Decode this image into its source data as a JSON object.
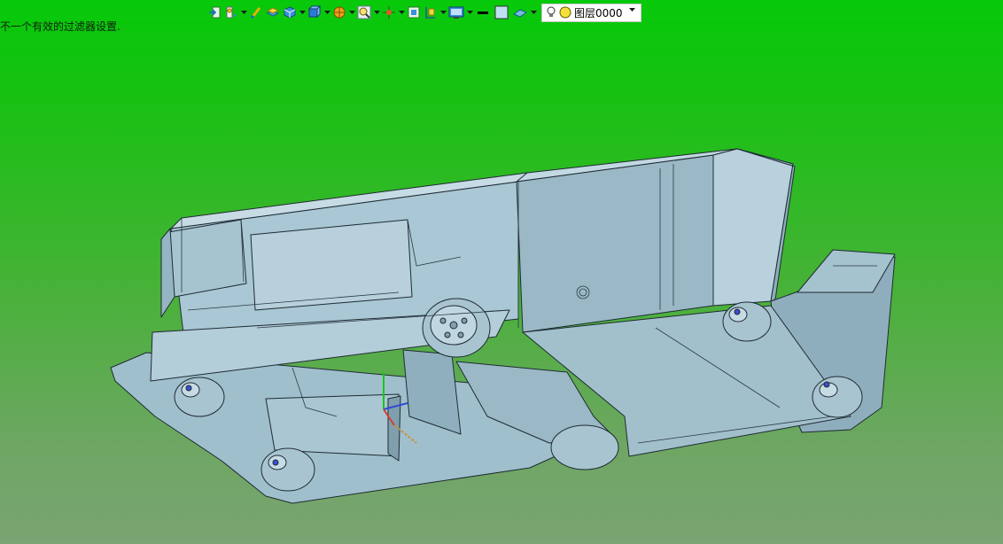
{
  "status": {
    "message": "不一个有效的过滤器设置."
  },
  "toolbar": {
    "buttons": [
      {
        "name": "exit-icon",
        "has_dropdown": false
      },
      {
        "name": "light-icon",
        "has_dropdown": true
      },
      {
        "name": "brush-icon",
        "has_dropdown": false
      },
      {
        "name": "layers-icon",
        "has_dropdown": false
      },
      {
        "name": "cube-icon",
        "has_dropdown": true
      },
      {
        "name": "view-cube-icon",
        "has_dropdown": true
      },
      {
        "name": "orbit-icon",
        "has_dropdown": true
      },
      {
        "name": "zoom-icon",
        "has_dropdown": true
      },
      {
        "name": "pan-icon",
        "has_dropdown": true
      },
      {
        "name": "fit-icon",
        "has_dropdown": false
      },
      {
        "name": "section-icon",
        "has_dropdown": true
      },
      {
        "name": "display-mode-icon",
        "has_dropdown": true
      },
      {
        "name": "line-color-icon",
        "has_dropdown": false
      },
      {
        "name": "fill-color-icon",
        "has_dropdown": false
      },
      {
        "name": "surface-icon",
        "has_dropdown": true
      }
    ],
    "layer": {
      "label": "图层0000",
      "bulb_icon": "lightbulb-icon",
      "state_icon": "yellow-circle-icon"
    }
  },
  "colors": {
    "background_top": "#07c90a",
    "background_bottom": "#7aa472",
    "model_fill": "#a9c6d3",
    "model_edge": "#1f2b33"
  }
}
